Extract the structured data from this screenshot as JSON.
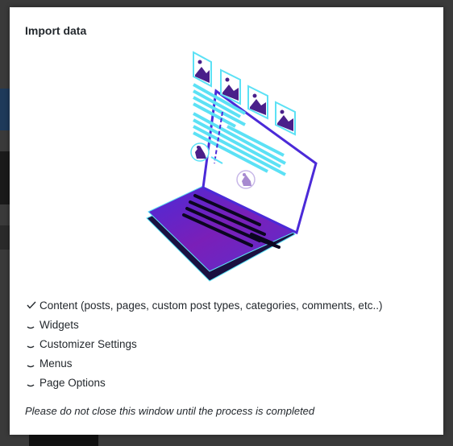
{
  "modal": {
    "title": "Import data",
    "notice": "Please do not close this window until the process is completed"
  },
  "steps": [
    {
      "label": "Content (posts, pages, custom post types, categories, comments, etc..)",
      "status": "done",
      "icon": "checkmark-icon"
    },
    {
      "label": "Widgets",
      "status": "pending",
      "icon": "spinner-icon"
    },
    {
      "label": "Customizer Settings",
      "status": "pending",
      "icon": "spinner-icon"
    },
    {
      "label": "Menus",
      "status": "pending",
      "icon": "spinner-icon"
    },
    {
      "label": "Page Options",
      "status": "pending",
      "icon": "spinner-icon"
    }
  ],
  "colors": {
    "accent_cyan": "#5ce1f5",
    "accent_purple": "#7a1fb8",
    "accent_violet": "#4b2ad8",
    "laptop_shadow": "#1a1040",
    "text": "#23282d"
  }
}
